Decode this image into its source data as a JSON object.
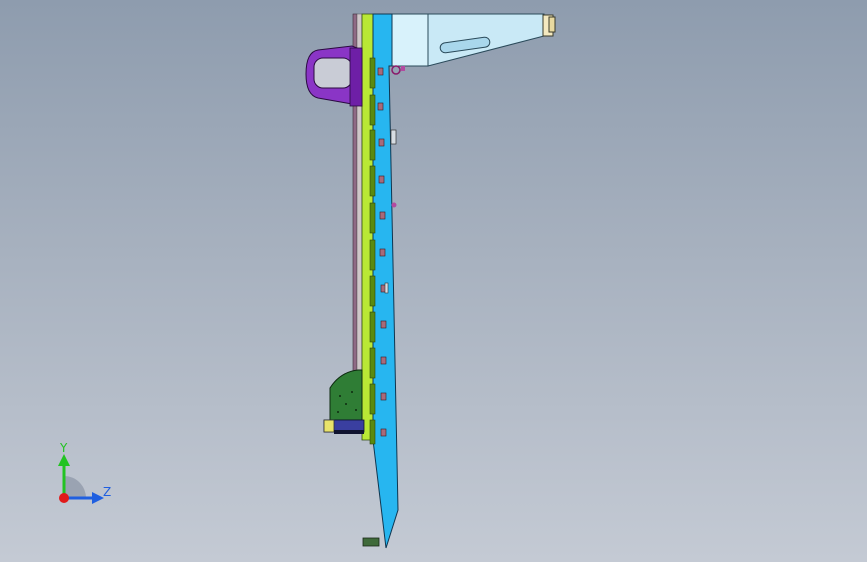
{
  "viewport": {
    "name": "cad-graphics-area",
    "colors": {
      "background_top": "#8e9cae",
      "background_bottom": "#c4cad4",
      "frame_blue": "#27b6f0",
      "rail_green": "#b9e835",
      "bracket_purple": "#8a35c6",
      "pcb_green": "#2f7d35",
      "bar_pale": "#c9e9f6"
    }
  },
  "triad": {
    "y_label": "Y",
    "z_label": "Z",
    "y_color": "#22c322",
    "z_color": "#1f5fe0",
    "x_color": "#e01919"
  }
}
